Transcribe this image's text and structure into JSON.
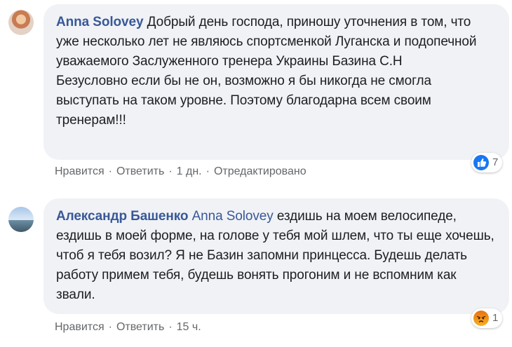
{
  "comments": [
    {
      "author": "Anna Solovey",
      "text": "Добрый день господа, приношу уточнения в том, что уже несколько лет не являюсь спортсменкой Луганска и подопечной уважаемого Заслуженного тренера Украины Базина С.Н",
      "text2": "Безусловно если бы не он, возможно я бы никогда не смогла выступать на таком уровне. Поэтому благодарна всем своим тренерам!!!",
      "actions": {
        "like": "Нравится",
        "reply": "Ответить",
        "time": "1 дн.",
        "edited": "Отредактировано"
      },
      "reaction": {
        "icon": "like-icon",
        "count": "7",
        "color": "#1877f2"
      }
    },
    {
      "author": "Александр Башенко",
      "mention": "Anna Solovey",
      "text": "ездишь на моем велосипеде, ездишь в моей форме, на голове у тебя мой шлем, что ты еще хочешь, чтоб я тебя возил? Я не Базин запомни принцесса. Будешь делать работу примем тебя, будешь вонять прогоним и не вспомним как звали.",
      "actions": {
        "like": "Нравится",
        "reply": "Ответить",
        "time": "15 ч."
      },
      "reaction": {
        "icon": "angry-icon",
        "count": "1",
        "color": "#e9710f"
      }
    }
  ],
  "separator": "·"
}
